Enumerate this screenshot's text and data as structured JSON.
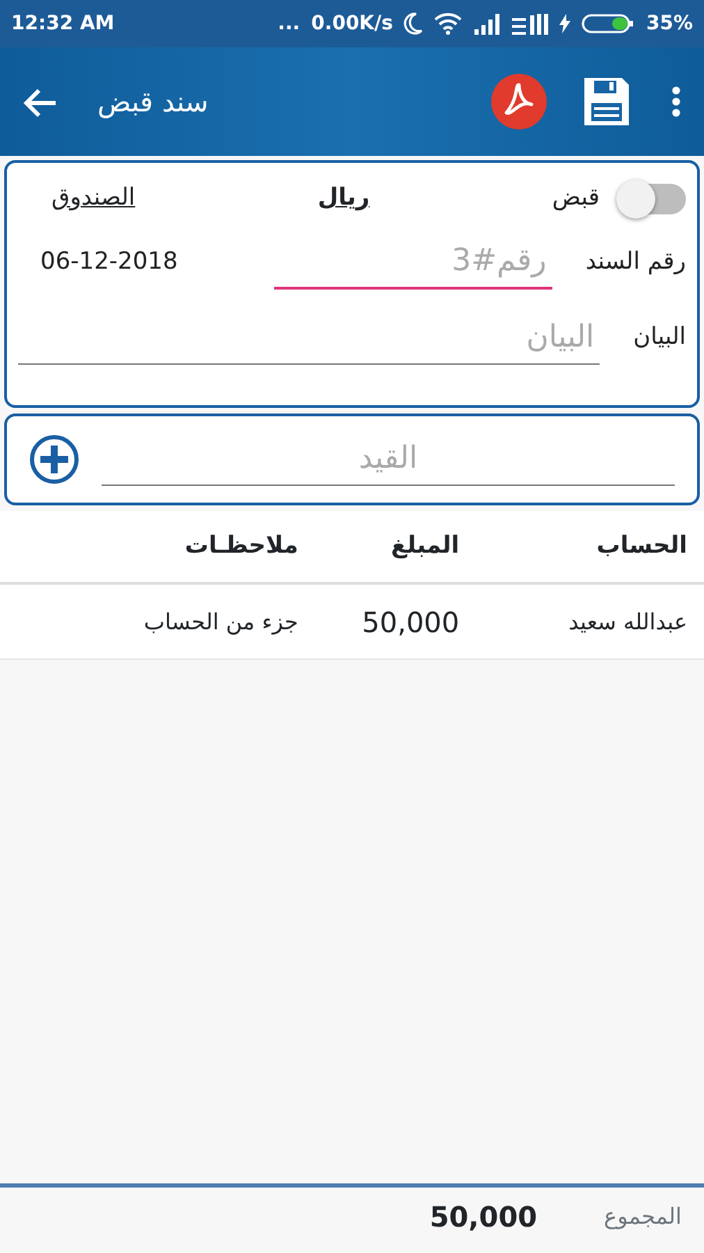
{
  "status_bar": {
    "time": "12:32 AM",
    "dots": "...",
    "speed": "0.00K/s",
    "battery": "35%"
  },
  "app_bar": {
    "title": "سند قبض"
  },
  "header": {
    "box_link": "الصندوق",
    "currency": "ريال",
    "switch": {
      "label": "قبض",
      "on": false
    }
  },
  "voucher": {
    "label": "رقم السند",
    "placeholder": "رقم#3",
    "focused": true,
    "date": "06-12-2018"
  },
  "description": {
    "label": "البيان",
    "placeholder": "البيان"
  },
  "entry": {
    "placeholder": "القيد"
  },
  "table": {
    "columns": [
      "الحساب",
      "المبلغ",
      "ملاحظـات"
    ],
    "rows": [
      [
        "عبدالله سعيد",
        "50,000",
        "جزء من الحساب"
      ]
    ]
  },
  "total": {
    "label": "المجموع",
    "value": "50,000"
  }
}
